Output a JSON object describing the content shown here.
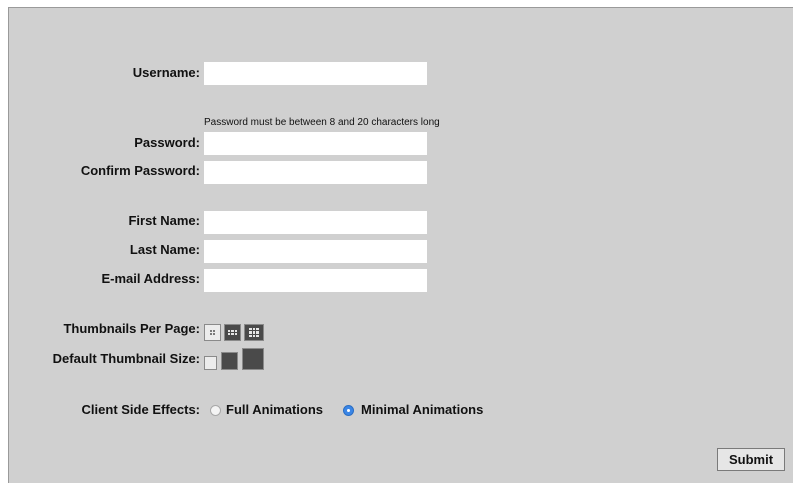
{
  "form": {
    "username": {
      "label": "Username:",
      "value": ""
    },
    "password_hint": "Password must be between 8 and 20 characters long",
    "password": {
      "label": "Password:",
      "value": ""
    },
    "confirm_password": {
      "label": "Confirm Password:",
      "value": ""
    },
    "first_name": {
      "label": "First Name:",
      "value": ""
    },
    "last_name": {
      "label": "Last Name:",
      "value": ""
    },
    "email": {
      "label": "E-mail Address:",
      "value": ""
    },
    "thumbnails_per_page": {
      "label": "Thumbnails Per Page:",
      "options": [
        "thumbnails-small-grid-icon",
        "thumbnails-medium-grid-icon",
        "thumbnails-large-grid-icon"
      ],
      "selected_index": 0
    },
    "default_thumbnail_size": {
      "label": "Default Thumbnail Size:",
      "options": [
        "small",
        "medium",
        "large"
      ],
      "selected_index": 0
    },
    "client_side_effects": {
      "label": "Client Side Effects:",
      "options": [
        {
          "label": "Full Animations",
          "selected": false
        },
        {
          "label": "Minimal Animations",
          "selected": true
        }
      ]
    },
    "submit_label": "Submit"
  },
  "colors": {
    "panel_bg": "#d0d0d0",
    "radio_selected": "#3b86e6",
    "dark_button": "#4a4a4a",
    "light_button": "#e8e8e8"
  }
}
